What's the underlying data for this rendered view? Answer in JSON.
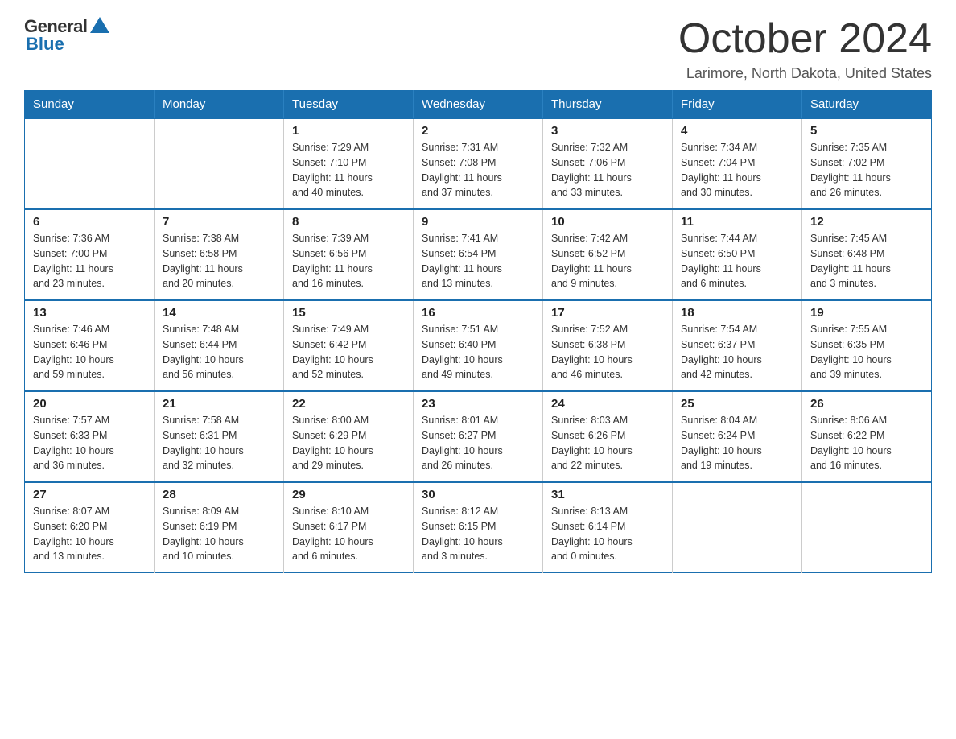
{
  "logo": {
    "general": "General",
    "blue": "Blue"
  },
  "title": "October 2024",
  "location": "Larimore, North Dakota, United States",
  "weekdays": [
    "Sunday",
    "Monday",
    "Tuesday",
    "Wednesday",
    "Thursday",
    "Friday",
    "Saturday"
  ],
  "weeks": [
    [
      {
        "day": "",
        "info": ""
      },
      {
        "day": "",
        "info": ""
      },
      {
        "day": "1",
        "info": "Sunrise: 7:29 AM\nSunset: 7:10 PM\nDaylight: 11 hours\nand 40 minutes."
      },
      {
        "day": "2",
        "info": "Sunrise: 7:31 AM\nSunset: 7:08 PM\nDaylight: 11 hours\nand 37 minutes."
      },
      {
        "day": "3",
        "info": "Sunrise: 7:32 AM\nSunset: 7:06 PM\nDaylight: 11 hours\nand 33 minutes."
      },
      {
        "day": "4",
        "info": "Sunrise: 7:34 AM\nSunset: 7:04 PM\nDaylight: 11 hours\nand 30 minutes."
      },
      {
        "day": "5",
        "info": "Sunrise: 7:35 AM\nSunset: 7:02 PM\nDaylight: 11 hours\nand 26 minutes."
      }
    ],
    [
      {
        "day": "6",
        "info": "Sunrise: 7:36 AM\nSunset: 7:00 PM\nDaylight: 11 hours\nand 23 minutes."
      },
      {
        "day": "7",
        "info": "Sunrise: 7:38 AM\nSunset: 6:58 PM\nDaylight: 11 hours\nand 20 minutes."
      },
      {
        "day": "8",
        "info": "Sunrise: 7:39 AM\nSunset: 6:56 PM\nDaylight: 11 hours\nand 16 minutes."
      },
      {
        "day": "9",
        "info": "Sunrise: 7:41 AM\nSunset: 6:54 PM\nDaylight: 11 hours\nand 13 minutes."
      },
      {
        "day": "10",
        "info": "Sunrise: 7:42 AM\nSunset: 6:52 PM\nDaylight: 11 hours\nand 9 minutes."
      },
      {
        "day": "11",
        "info": "Sunrise: 7:44 AM\nSunset: 6:50 PM\nDaylight: 11 hours\nand 6 minutes."
      },
      {
        "day": "12",
        "info": "Sunrise: 7:45 AM\nSunset: 6:48 PM\nDaylight: 11 hours\nand 3 minutes."
      }
    ],
    [
      {
        "day": "13",
        "info": "Sunrise: 7:46 AM\nSunset: 6:46 PM\nDaylight: 10 hours\nand 59 minutes."
      },
      {
        "day": "14",
        "info": "Sunrise: 7:48 AM\nSunset: 6:44 PM\nDaylight: 10 hours\nand 56 minutes."
      },
      {
        "day": "15",
        "info": "Sunrise: 7:49 AM\nSunset: 6:42 PM\nDaylight: 10 hours\nand 52 minutes."
      },
      {
        "day": "16",
        "info": "Sunrise: 7:51 AM\nSunset: 6:40 PM\nDaylight: 10 hours\nand 49 minutes."
      },
      {
        "day": "17",
        "info": "Sunrise: 7:52 AM\nSunset: 6:38 PM\nDaylight: 10 hours\nand 46 minutes."
      },
      {
        "day": "18",
        "info": "Sunrise: 7:54 AM\nSunset: 6:37 PM\nDaylight: 10 hours\nand 42 minutes."
      },
      {
        "day": "19",
        "info": "Sunrise: 7:55 AM\nSunset: 6:35 PM\nDaylight: 10 hours\nand 39 minutes."
      }
    ],
    [
      {
        "day": "20",
        "info": "Sunrise: 7:57 AM\nSunset: 6:33 PM\nDaylight: 10 hours\nand 36 minutes."
      },
      {
        "day": "21",
        "info": "Sunrise: 7:58 AM\nSunset: 6:31 PM\nDaylight: 10 hours\nand 32 minutes."
      },
      {
        "day": "22",
        "info": "Sunrise: 8:00 AM\nSunset: 6:29 PM\nDaylight: 10 hours\nand 29 minutes."
      },
      {
        "day": "23",
        "info": "Sunrise: 8:01 AM\nSunset: 6:27 PM\nDaylight: 10 hours\nand 26 minutes."
      },
      {
        "day": "24",
        "info": "Sunrise: 8:03 AM\nSunset: 6:26 PM\nDaylight: 10 hours\nand 22 minutes."
      },
      {
        "day": "25",
        "info": "Sunrise: 8:04 AM\nSunset: 6:24 PM\nDaylight: 10 hours\nand 19 minutes."
      },
      {
        "day": "26",
        "info": "Sunrise: 8:06 AM\nSunset: 6:22 PM\nDaylight: 10 hours\nand 16 minutes."
      }
    ],
    [
      {
        "day": "27",
        "info": "Sunrise: 8:07 AM\nSunset: 6:20 PM\nDaylight: 10 hours\nand 13 minutes."
      },
      {
        "day": "28",
        "info": "Sunrise: 8:09 AM\nSunset: 6:19 PM\nDaylight: 10 hours\nand 10 minutes."
      },
      {
        "day": "29",
        "info": "Sunrise: 8:10 AM\nSunset: 6:17 PM\nDaylight: 10 hours\nand 6 minutes."
      },
      {
        "day": "30",
        "info": "Sunrise: 8:12 AM\nSunset: 6:15 PM\nDaylight: 10 hours\nand 3 minutes."
      },
      {
        "day": "31",
        "info": "Sunrise: 8:13 AM\nSunset: 6:14 PM\nDaylight: 10 hours\nand 0 minutes."
      },
      {
        "day": "",
        "info": ""
      },
      {
        "day": "",
        "info": ""
      }
    ]
  ]
}
